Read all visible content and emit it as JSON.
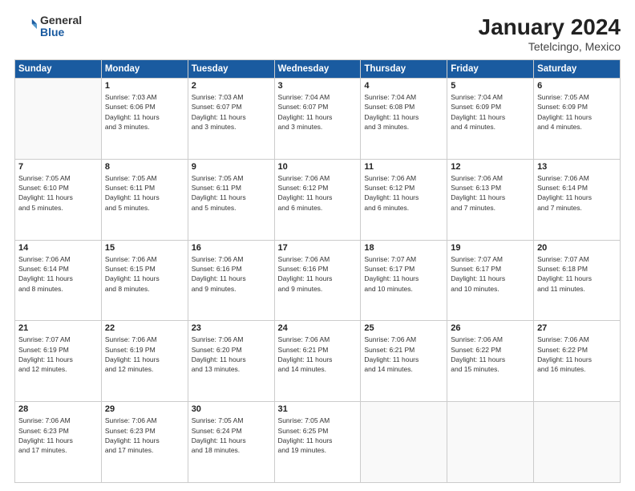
{
  "header": {
    "logo_general": "General",
    "logo_blue": "Blue",
    "title": "January 2024",
    "subtitle": "Tetelcingo, Mexico"
  },
  "days_of_week": [
    "Sunday",
    "Monday",
    "Tuesday",
    "Wednesday",
    "Thursday",
    "Friday",
    "Saturday"
  ],
  "weeks": [
    [
      {
        "day": "",
        "info": ""
      },
      {
        "day": "1",
        "info": "Sunrise: 7:03 AM\nSunset: 6:06 PM\nDaylight: 11 hours\nand 3 minutes."
      },
      {
        "day": "2",
        "info": "Sunrise: 7:03 AM\nSunset: 6:07 PM\nDaylight: 11 hours\nand 3 minutes."
      },
      {
        "day": "3",
        "info": "Sunrise: 7:04 AM\nSunset: 6:07 PM\nDaylight: 11 hours\nand 3 minutes."
      },
      {
        "day": "4",
        "info": "Sunrise: 7:04 AM\nSunset: 6:08 PM\nDaylight: 11 hours\nand 3 minutes."
      },
      {
        "day": "5",
        "info": "Sunrise: 7:04 AM\nSunset: 6:09 PM\nDaylight: 11 hours\nand 4 minutes."
      },
      {
        "day": "6",
        "info": "Sunrise: 7:05 AM\nSunset: 6:09 PM\nDaylight: 11 hours\nand 4 minutes."
      }
    ],
    [
      {
        "day": "7",
        "info": "Sunrise: 7:05 AM\nSunset: 6:10 PM\nDaylight: 11 hours\nand 5 minutes."
      },
      {
        "day": "8",
        "info": "Sunrise: 7:05 AM\nSunset: 6:11 PM\nDaylight: 11 hours\nand 5 minutes."
      },
      {
        "day": "9",
        "info": "Sunrise: 7:05 AM\nSunset: 6:11 PM\nDaylight: 11 hours\nand 5 minutes."
      },
      {
        "day": "10",
        "info": "Sunrise: 7:06 AM\nSunset: 6:12 PM\nDaylight: 11 hours\nand 6 minutes."
      },
      {
        "day": "11",
        "info": "Sunrise: 7:06 AM\nSunset: 6:12 PM\nDaylight: 11 hours\nand 6 minutes."
      },
      {
        "day": "12",
        "info": "Sunrise: 7:06 AM\nSunset: 6:13 PM\nDaylight: 11 hours\nand 7 minutes."
      },
      {
        "day": "13",
        "info": "Sunrise: 7:06 AM\nSunset: 6:14 PM\nDaylight: 11 hours\nand 7 minutes."
      }
    ],
    [
      {
        "day": "14",
        "info": "Sunrise: 7:06 AM\nSunset: 6:14 PM\nDaylight: 11 hours\nand 8 minutes."
      },
      {
        "day": "15",
        "info": "Sunrise: 7:06 AM\nSunset: 6:15 PM\nDaylight: 11 hours\nand 8 minutes."
      },
      {
        "day": "16",
        "info": "Sunrise: 7:06 AM\nSunset: 6:16 PM\nDaylight: 11 hours\nand 9 minutes."
      },
      {
        "day": "17",
        "info": "Sunrise: 7:06 AM\nSunset: 6:16 PM\nDaylight: 11 hours\nand 9 minutes."
      },
      {
        "day": "18",
        "info": "Sunrise: 7:07 AM\nSunset: 6:17 PM\nDaylight: 11 hours\nand 10 minutes."
      },
      {
        "day": "19",
        "info": "Sunrise: 7:07 AM\nSunset: 6:17 PM\nDaylight: 11 hours\nand 10 minutes."
      },
      {
        "day": "20",
        "info": "Sunrise: 7:07 AM\nSunset: 6:18 PM\nDaylight: 11 hours\nand 11 minutes."
      }
    ],
    [
      {
        "day": "21",
        "info": "Sunrise: 7:07 AM\nSunset: 6:19 PM\nDaylight: 11 hours\nand 12 minutes."
      },
      {
        "day": "22",
        "info": "Sunrise: 7:06 AM\nSunset: 6:19 PM\nDaylight: 11 hours\nand 12 minutes."
      },
      {
        "day": "23",
        "info": "Sunrise: 7:06 AM\nSunset: 6:20 PM\nDaylight: 11 hours\nand 13 minutes."
      },
      {
        "day": "24",
        "info": "Sunrise: 7:06 AM\nSunset: 6:21 PM\nDaylight: 11 hours\nand 14 minutes."
      },
      {
        "day": "25",
        "info": "Sunrise: 7:06 AM\nSunset: 6:21 PM\nDaylight: 11 hours\nand 14 minutes."
      },
      {
        "day": "26",
        "info": "Sunrise: 7:06 AM\nSunset: 6:22 PM\nDaylight: 11 hours\nand 15 minutes."
      },
      {
        "day": "27",
        "info": "Sunrise: 7:06 AM\nSunset: 6:22 PM\nDaylight: 11 hours\nand 16 minutes."
      }
    ],
    [
      {
        "day": "28",
        "info": "Sunrise: 7:06 AM\nSunset: 6:23 PM\nDaylight: 11 hours\nand 17 minutes."
      },
      {
        "day": "29",
        "info": "Sunrise: 7:06 AM\nSunset: 6:23 PM\nDaylight: 11 hours\nand 17 minutes."
      },
      {
        "day": "30",
        "info": "Sunrise: 7:05 AM\nSunset: 6:24 PM\nDaylight: 11 hours\nand 18 minutes."
      },
      {
        "day": "31",
        "info": "Sunrise: 7:05 AM\nSunset: 6:25 PM\nDaylight: 11 hours\nand 19 minutes."
      },
      {
        "day": "",
        "info": ""
      },
      {
        "day": "",
        "info": ""
      },
      {
        "day": "",
        "info": ""
      }
    ]
  ]
}
